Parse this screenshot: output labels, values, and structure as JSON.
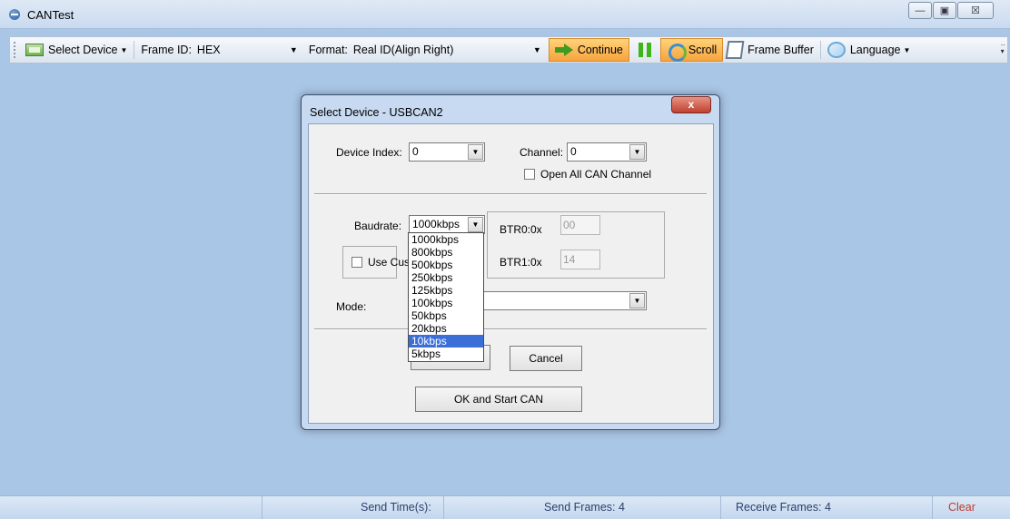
{
  "window": {
    "title": "CANTest",
    "min_icon": "minimize-icon",
    "max_icon": "maximize-icon",
    "close_label": "☒"
  },
  "toolbar": {
    "select_device": "Select Device",
    "frame_id_label": "Frame ID:",
    "frame_id_value": "HEX",
    "format_label": "Format:",
    "format_value": "Real ID(Align Right)",
    "continue": "Continue",
    "scroll": "Scroll",
    "frame_buffer": "Frame Buffer",
    "language": "Language"
  },
  "dialog": {
    "title": "Select Device - USBCAN2",
    "close_label": "x",
    "device_index_label": "Device Index:",
    "device_index_value": "0",
    "channel_label": "Channel:",
    "channel_value": "0",
    "open_all_label": "Open All CAN Channel",
    "baudrate_label": "Baudrate:",
    "baudrate_value": "1000kbps",
    "btr0_label": "BTR0:0x",
    "btr0_value": "00",
    "btr1_label": "BTR1:0x",
    "btr1_value": "14",
    "use_custom_label": "Use Cus",
    "mode_label": "Mode:",
    "mode_value": "",
    "cancel_button": "Cancel",
    "ok_start_button": "OK and Start CAN",
    "baudrate_options": [
      "1000kbps",
      "800kbps",
      "500kbps",
      "250kbps",
      "125kbps",
      "100kbps",
      "50kbps",
      "20kbps",
      "10kbps",
      "5kbps"
    ],
    "baudrate_highlighted": "10kbps"
  },
  "statusbar": {
    "send_time_label": "Send Time(s):",
    "send_frames": "Send Frames: 4",
    "receive_frames": "Receive Frames: 4",
    "clear": "Clear"
  },
  "colors": {
    "desktop": "#a9c6e6",
    "highlight": "#3b6fd8",
    "accent_orange": "#f7a33d"
  }
}
